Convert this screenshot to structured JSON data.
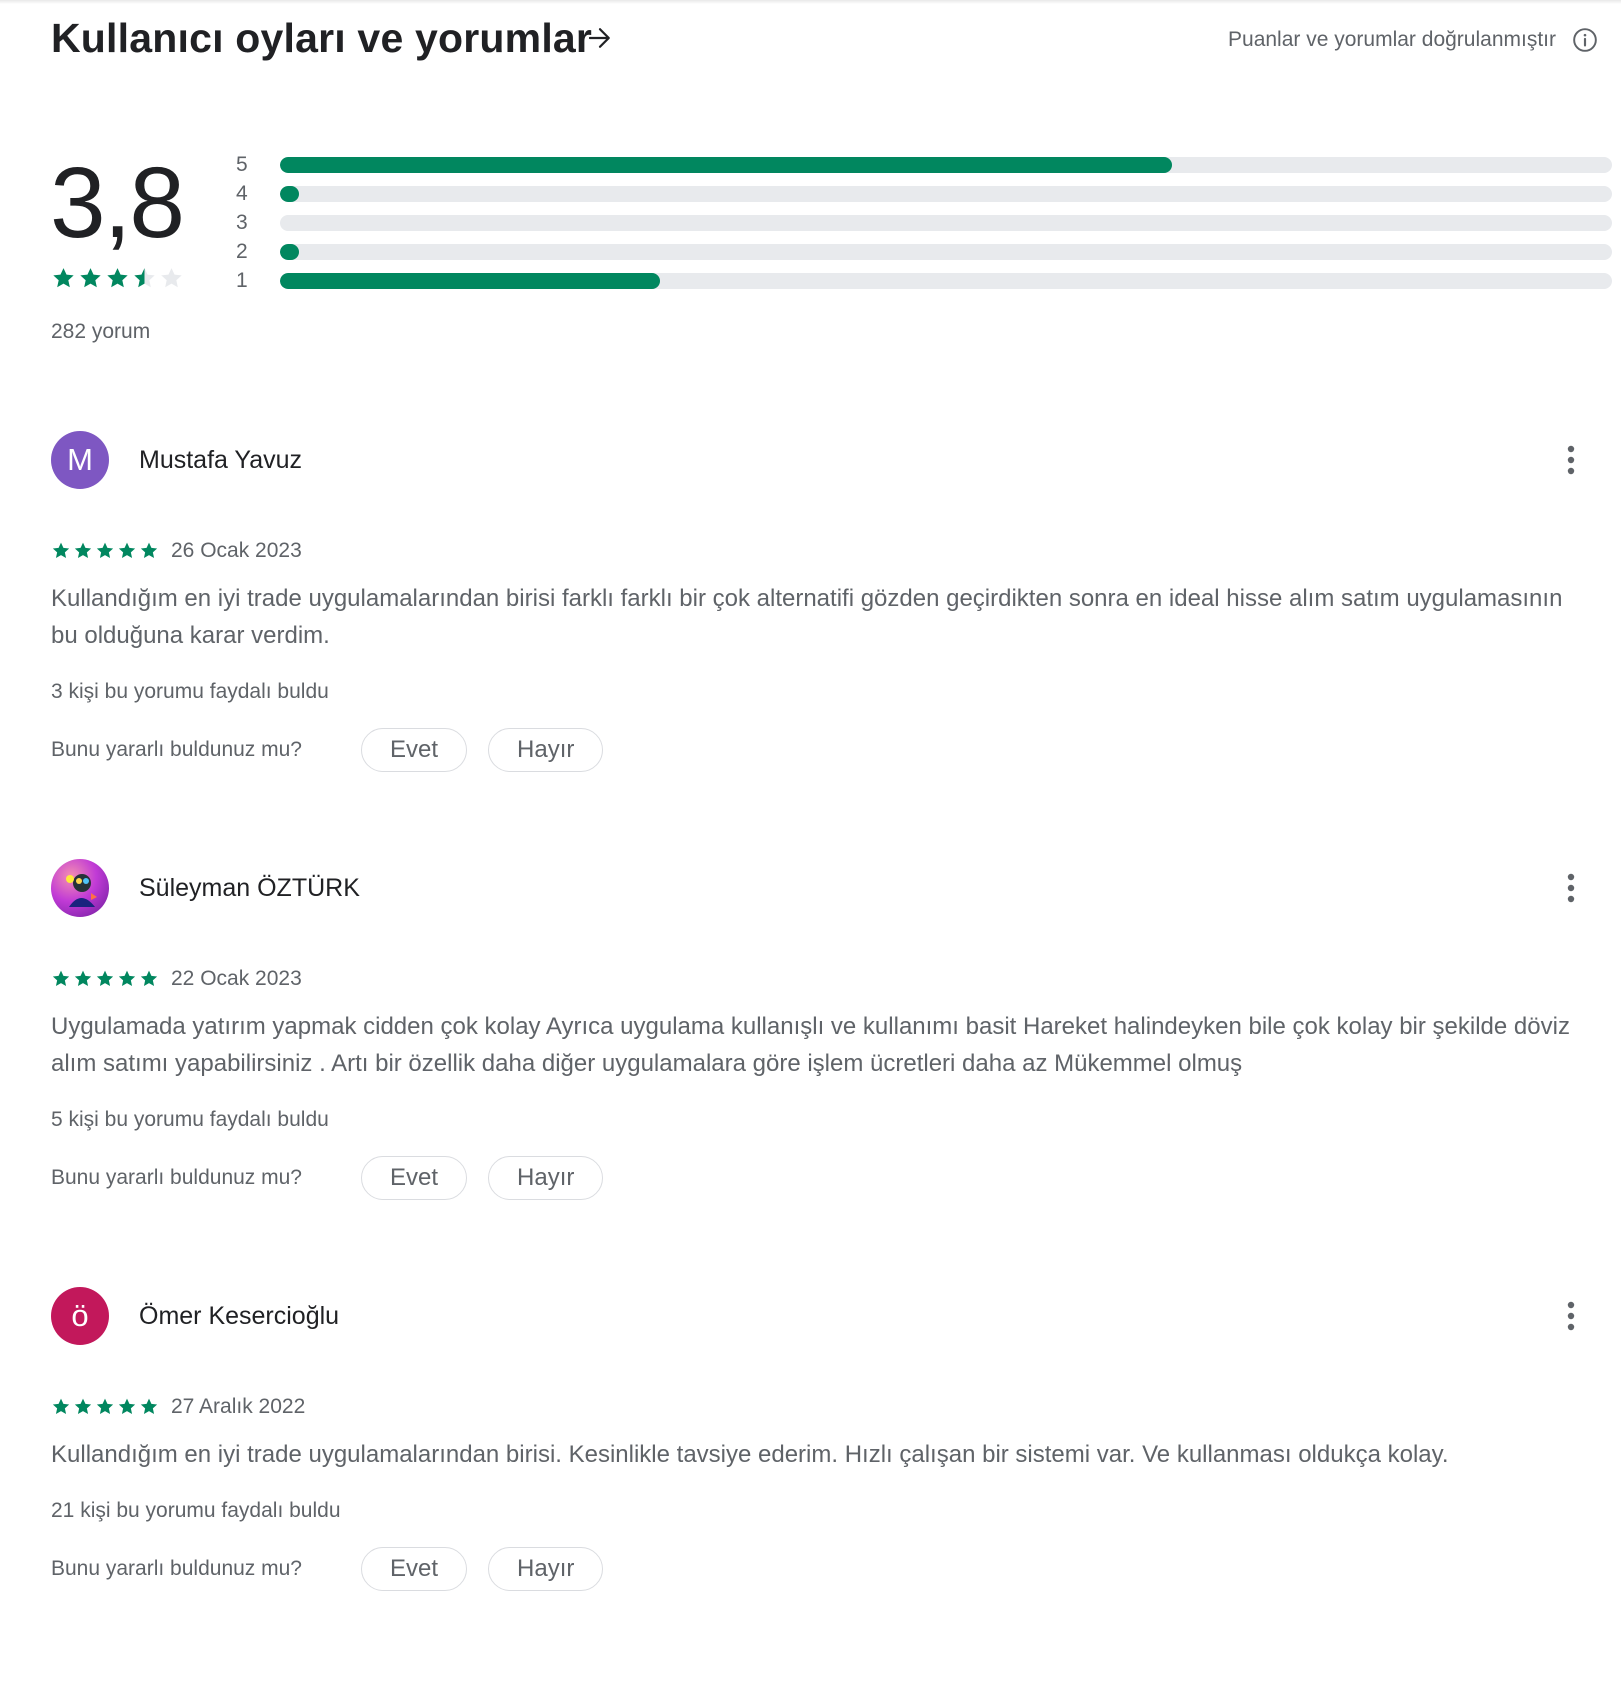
{
  "header": {
    "title": "Kullanıcı oyları ve yorumlar",
    "verified_text": "Puanlar ve yorumlar doğrulanmıştır"
  },
  "summary": {
    "rating": "3,8",
    "rating_value": 3.8,
    "review_count": "282 yorum",
    "histogram": [
      {
        "label": "5",
        "fraction": 0.67
      },
      {
        "label": "4",
        "fraction": 0.01
      },
      {
        "label": "3",
        "fraction": 0.0
      },
      {
        "label": "2",
        "fraction": 0.01
      },
      {
        "label": "1",
        "fraction": 0.285
      }
    ]
  },
  "colors": {
    "accent": "#01875f",
    "track": "#e8eaed",
    "empty_star": "#e8eaed"
  },
  "reviews": [
    {
      "name": "Mustafa Yavuz",
      "avatar_letter": "M",
      "avatar_color": "#7e57c2",
      "stars": 5,
      "date": "26 Ocak 2023",
      "text": "Kullandığım en iyi trade uygulamalarından birisi farklı farklı bir çok alternatifi gözden geçirdikten sonra en ideal hisse alım satım uygulamasının bu olduğuna karar verdim.",
      "helpful": "3 kişi bu yorumu faydalı buldu",
      "feedback_label": "Bunu yararlı buldunuz mu?",
      "yes_label": "Evet",
      "no_label": "Hayır"
    },
    {
      "name": "Süleyman ÖZTÜRK",
      "avatar_letter": "",
      "avatar_color": "#c13bd6",
      "stars": 5,
      "date": "22 Ocak 2023",
      "text": "Uygulamada yatırım yapmak cidden çok kolay Ayrıca uygulama kullanışlı ve kullanımı basit Hareket halindeyken bile çok kolay bir şekilde döviz alım satımı yapabilirsiniz . Artı bir özellik daha diğer uygulamalara göre işlem ücretleri daha az Mükemmel olmuş",
      "helpful": "5 kişi bu yorumu faydalı buldu",
      "feedback_label": "Bunu yararlı buldunuz mu?",
      "yes_label": "Evet",
      "no_label": "Hayır"
    },
    {
      "name": "Ömer Kesercioğlu",
      "avatar_letter": "ö",
      "avatar_color": "#c2185b",
      "stars": 5,
      "date": "27 Aralık 2022",
      "text": "Kullandığım en iyi trade uygulamalarından birisi. Kesinlikle tavsiye ederim. Hızlı çalışan bir sistemi var. Ve kullanması oldukça kolay.",
      "helpful": "21 kişi bu yorumu faydalı buldu",
      "feedback_label": "Bunu yararlı buldunuz mu?",
      "yes_label": "Evet",
      "no_label": "Hayır"
    }
  ]
}
